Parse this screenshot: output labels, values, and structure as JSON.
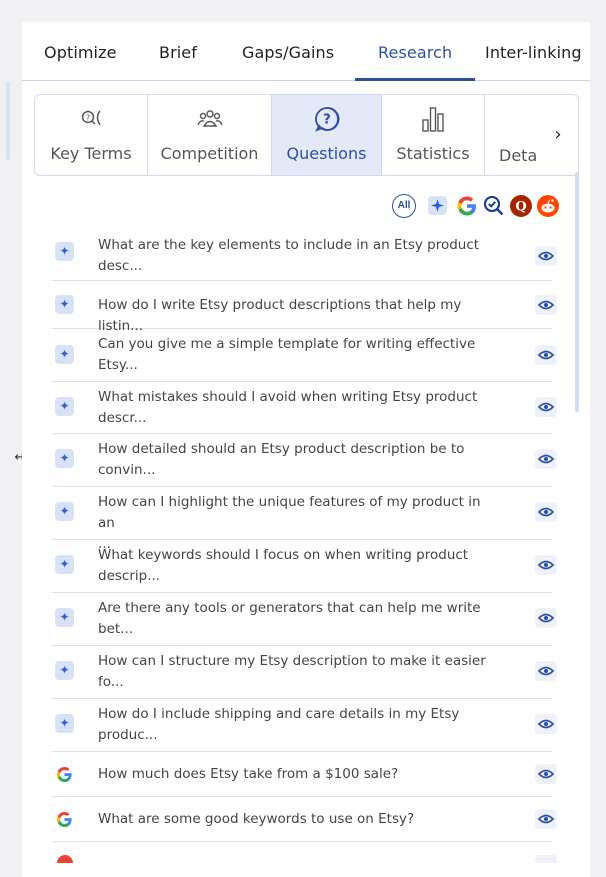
{
  "top_tabs": [
    {
      "label": "Optimize"
    },
    {
      "label": "Brief"
    },
    {
      "label": "Gaps/Gains"
    },
    {
      "label": "Research"
    },
    {
      "label": "Inter-linking"
    }
  ],
  "sub_tabs": [
    {
      "label": "Key Terms",
      "icon": "key-terms-icon"
    },
    {
      "label": "Competition",
      "icon": "users-icon"
    },
    {
      "label": "Questions",
      "icon": "question-icon"
    },
    {
      "label": "Statistics",
      "icon": "bar-chart-icon"
    },
    {
      "label": "Deta",
      "icon": "details-icon"
    }
  ],
  "filters": {
    "all_label": "All",
    "sources": [
      "ai-sparkle-icon",
      "google-icon",
      "search-check-icon",
      "quora-icon",
      "reddit-icon"
    ]
  },
  "colors": {
    "accent": "#2c4fa0",
    "active_tab_bg": "#e3e9f7",
    "ai_icon_bg": "#d8e2f7",
    "quora": "#a82400",
    "reddit": "#ff4500"
  },
  "questions": [
    {
      "source": "ai",
      "line1": "What are the key elements to include in an Etsy product",
      "line2": "desc..."
    },
    {
      "source": "ai",
      "line1": "How do I write Etsy product descriptions that help my listin...",
      "line2": ""
    },
    {
      "source": "ai",
      "line1": "Can you give me a simple template for writing effective",
      "line2": "Etsy..."
    },
    {
      "source": "ai",
      "line1": "What mistakes should I avoid when writing Etsy product",
      "line2": "descr..."
    },
    {
      "source": "ai",
      "line1": "How detailed should an Etsy product description be to",
      "line2": "convin..."
    },
    {
      "source": "ai",
      "line1": "How can I highlight the unique features of my product in an",
      "line2": "..."
    },
    {
      "source": "ai",
      "line1": "What keywords should I focus on when writing product",
      "line2": "descrip..."
    },
    {
      "source": "ai",
      "line1": "Are there any tools or generators that can help me write",
      "line2": "bet..."
    },
    {
      "source": "ai",
      "line1": "How can I structure my Etsy description to make it easier",
      "line2": "fo..."
    },
    {
      "source": "ai",
      "line1": "How do I include shipping and care details in my Etsy",
      "line2": "produc..."
    },
    {
      "source": "google",
      "line1": "How much does Etsy take from a $100 sale?",
      "line2": ""
    },
    {
      "source": "google",
      "line1": "What are some good keywords to use on Etsy?",
      "line2": ""
    }
  ]
}
